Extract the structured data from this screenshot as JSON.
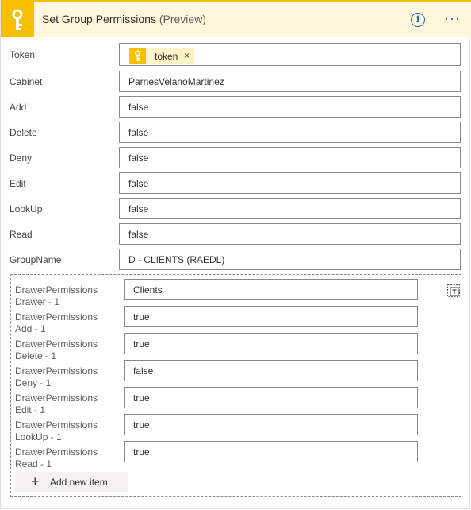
{
  "header": {
    "title": "Set Group Permissions",
    "preview": "(Preview)"
  },
  "fields": [
    {
      "label": "Token",
      "chip": "token"
    },
    {
      "label": "Cabinet",
      "value": "ParnesVelanoMartinez"
    },
    {
      "label": "Add",
      "value": "false"
    },
    {
      "label": "Delete",
      "value": "false"
    },
    {
      "label": "Deny",
      "value": "false"
    },
    {
      "label": "Edit",
      "value": "false"
    },
    {
      "label": "LookUp",
      "value": "false"
    },
    {
      "label": "Read",
      "value": "false"
    },
    {
      "label": "GroupName",
      "value": "D - CLIENTS (RAEDL)"
    }
  ],
  "drawer_items": [
    {
      "label1": "DrawerPermissions",
      "label2": "Drawer - 1",
      "value": "Clients"
    },
    {
      "label1": "DrawerPermissions",
      "label2": "Add - 1",
      "value": "true"
    },
    {
      "label1": "DrawerPermissions",
      "label2": "Delete - 1",
      "value": "true"
    },
    {
      "label1": "DrawerPermissions",
      "label2": "Deny - 1",
      "value": "false"
    },
    {
      "label1": "DrawerPermissions",
      "label2": "Edit - 1",
      "value": "true"
    },
    {
      "label1": "DrawerPermissions",
      "label2": "LookUp - 1",
      "value": "true"
    },
    {
      "label1": "DrawerPermissions",
      "label2": "Read - 1",
      "value": "true"
    }
  ],
  "add_item_label": "Add new item",
  "colors": {
    "accent": "#f7c100",
    "header_bg": "#fff7dc",
    "link": "#0f6cbd"
  },
  "icons": {
    "app": "key-icon",
    "info": "info-icon",
    "more": "ellipsis-icon",
    "switch_mode": "switch-to-text-mode-icon",
    "add": "plus-icon"
  }
}
